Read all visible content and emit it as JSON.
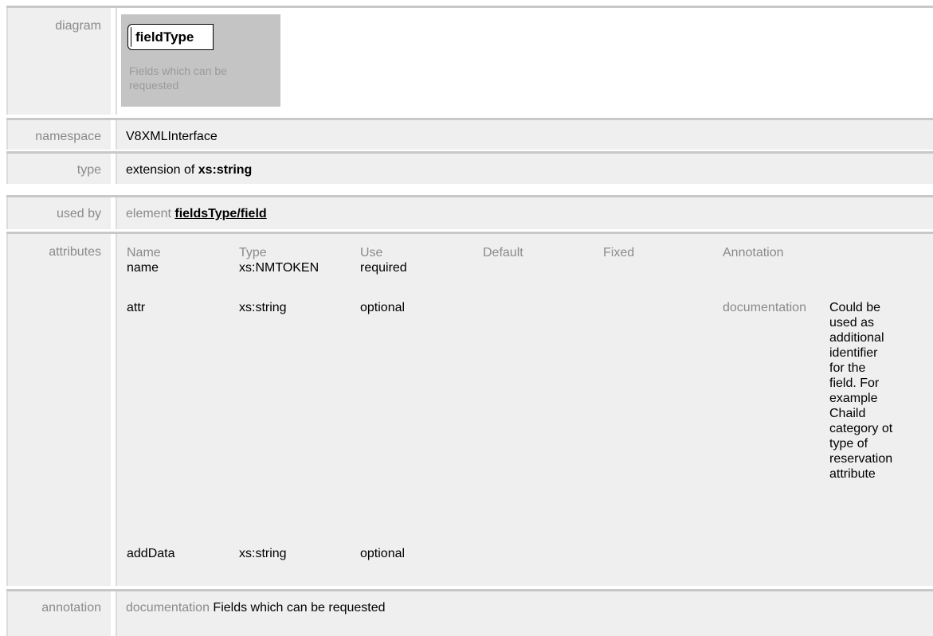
{
  "rows": {
    "diagram": {
      "label": "diagram",
      "box_title": "fieldType",
      "caption": "Fields which can be requested"
    },
    "namespace": {
      "label": "namespace",
      "value": "V8XMLInterface"
    },
    "type": {
      "label": "type",
      "prefix": "extension of",
      "base": "xs:string"
    },
    "used_by": {
      "label": "used by",
      "prefix": "element",
      "link": "fieldsType/field"
    },
    "attributes": {
      "label": "attributes",
      "headers": [
        "Name",
        "Type",
        "Use",
        "Default",
        "Fixed",
        "Annotation"
      ],
      "items": [
        {
          "name": "name",
          "type": "xs:NMTOKEN",
          "use": "required"
        },
        {
          "name": "attr",
          "type": "xs:string",
          "use": "optional",
          "annotation_label": "documentation",
          "annotation_lines": [
            "Could be",
            "used as",
            "additional",
            "identifier",
            "for the",
            "field. For",
            "example",
            "Chaild",
            "category ot",
            "type of",
            "reservation",
            "attribute"
          ]
        },
        {
          "name": "addData",
          "type": "xs:string",
          "use": "optional"
        }
      ]
    },
    "annotation": {
      "label": "annotation",
      "doc_label": "documentation",
      "text": "Fields which can be requested"
    }
  }
}
